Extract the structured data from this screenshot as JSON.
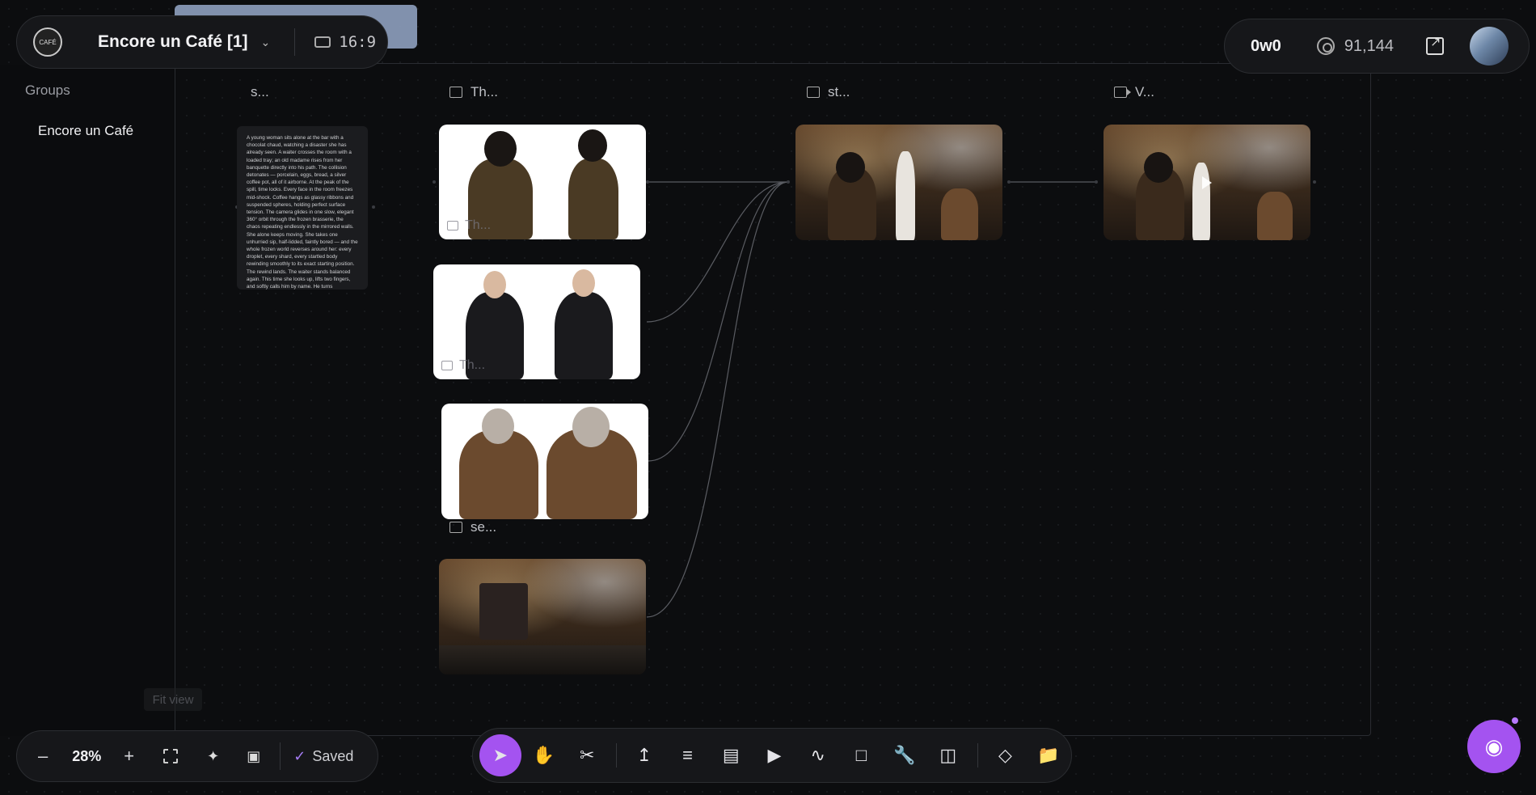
{
  "project": {
    "logo_text": "CAFÉ",
    "title": "Encore un Café [1]",
    "aspect_ratio": "16:9"
  },
  "account": {
    "handle": "0w0",
    "credits": "91,144"
  },
  "groups_panel": {
    "title": "Groups",
    "items": [
      "Encore un Café"
    ]
  },
  "nodes": {
    "script": {
      "label": "s...",
      "text": "A young woman sits alone at the bar with a chocolat chaud, watching a disaster she has already seen. A waiter crosses the room with a loaded tray; an old madame rises from her banquette directly into his path. The collision detonates — porcelain, eggs, bread, a silver coffee pot, all of it airborne. At the peak of the spill, time locks. Every face in the room freezes mid-shock. Coffee hangs as glassy ribbons and suspended spheres, holding perfect surface tension. The camera glides in one slow, elegant 360° orbit through the frozen brasserie, the chaos repeating endlessly in the mirrored walls. She alone keeps moving. She takes one unhurried sip, half-lidded, faintly bored — and the whole frozen world reverses around her: every droplet, every shard, every startled body rewinding smoothly to its exact starting position. The rewind lands. The waiter stands balanced again. This time she looks up, lifts two fingers, and softly calls him by name. He turns"
    },
    "character_woman": {
      "label": "Th...",
      "caption": "Th..."
    },
    "character_waiter": {
      "label": "Th...",
      "caption": "Th..."
    },
    "character_madame": {
      "label": "Th...",
      "caption": ""
    },
    "setting": {
      "label": "se..."
    },
    "storyboard": {
      "label": "st..."
    },
    "video": {
      "label": "V..."
    }
  },
  "canvas": {
    "fit_view_label": "Fit view"
  },
  "zoom": {
    "level": "28%",
    "minus": "–",
    "plus": "+",
    "saved": "Saved"
  },
  "toolbar": {
    "tools": [
      "select-icon",
      "hand-icon",
      "scissors-icon",
      "upload-icon",
      "text-icon",
      "image-icon",
      "video-icon",
      "audio-icon",
      "note-icon",
      "wrench-icon",
      "nodes-icon",
      "gem-icon",
      "folder-icon"
    ]
  },
  "colors": {
    "accent": "#a453f0",
    "background": "#0c0d0f",
    "panel": "#16171a"
  }
}
